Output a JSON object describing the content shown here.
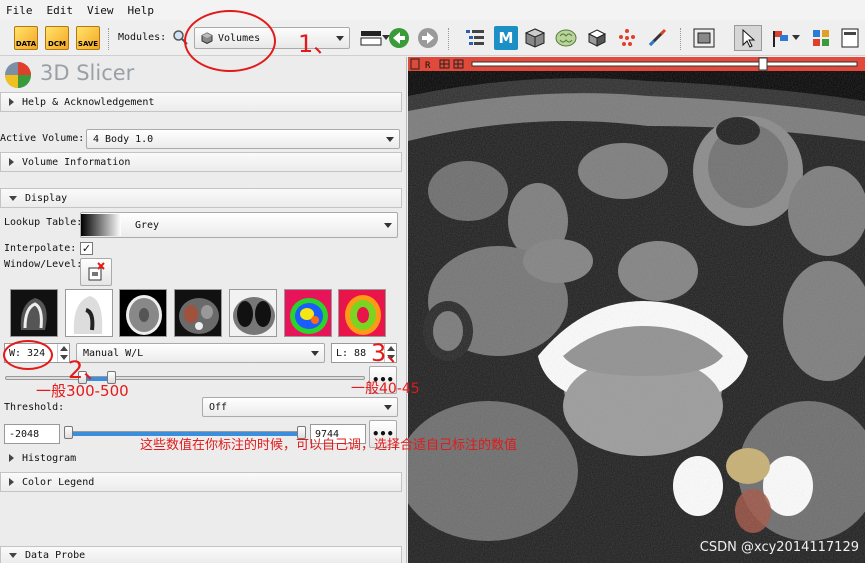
{
  "menu": [
    "File",
    "Edit",
    "View",
    "Help"
  ],
  "toolbar": {
    "data_label": "DATA",
    "dcm_label": "DCM",
    "save_label": "SAVE",
    "modules_label": "Modules:",
    "module_selected": "Volumes"
  },
  "app_title": "3D Slicer",
  "sections": {
    "help": "Help & Acknowledgement",
    "volume_info": "Volume Information",
    "display": "Display",
    "histogram": "Histogram",
    "color_legend": "Color Legend",
    "data_probe": "Data Probe"
  },
  "active_volume": {
    "label": "Active Volume:",
    "value": "4 Body 1.0"
  },
  "display": {
    "lookup_label": "Lookup Table:",
    "lookup_value": "Grey",
    "interpolate_label": "Interpolate:",
    "interpolate_checked": "✓",
    "window_level_label": "Window/Level:",
    "window_value": "W: 324",
    "window_mode": "Manual W/L",
    "level_value": "L: 88",
    "threshold_label": "Threshold:",
    "threshold_value": "Off",
    "threshold_min": "-2048",
    "threshold_max": "9744",
    "more": "•••"
  },
  "annotations": {
    "num1": "1、",
    "num2": "2、",
    "num3": "3、",
    "window_range": "一般300-500",
    "level_range": "一般40-45",
    "note": "这些数值在你标注的时候，可以自己调，选择合适自己标注的数值"
  },
  "viewer": {
    "bar_label": "R",
    "watermark": "CSDN @xcy2014117129"
  },
  "colors": {
    "annotation": "#e21a1a",
    "slice_bar": "#e14a3b"
  }
}
